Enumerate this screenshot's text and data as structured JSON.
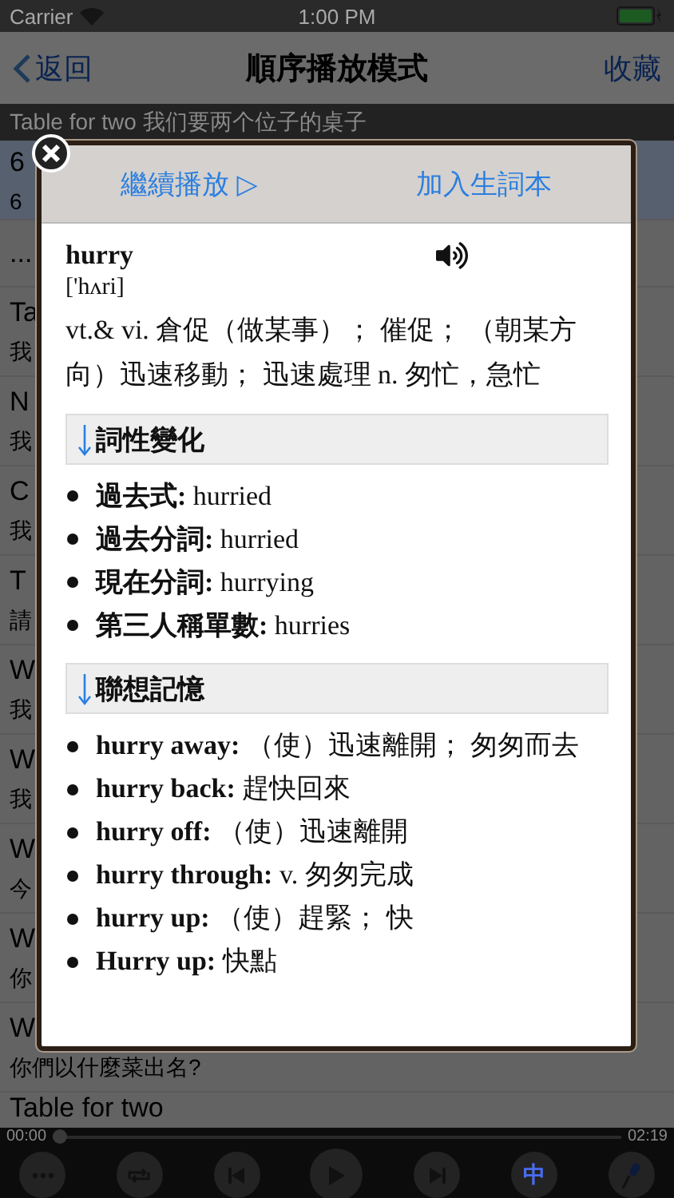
{
  "status_bar": {
    "carrier": "Carrier",
    "time": "1:00 PM"
  },
  "nav": {
    "back": "返回",
    "title": "順序播放模式",
    "action": "收藏"
  },
  "now_playing": "Table for two 我们要两个位子的桌子",
  "list": [
    {
      "title": "6",
      "subtitle": "6",
      "selected": true
    },
    {
      "title": "...",
      "selected": false
    },
    {
      "title": "Ta",
      "subtitle": "我",
      "selected": false
    },
    {
      "title": "N",
      "subtitle": "我",
      "selected": false
    },
    {
      "title": "C",
      "subtitle": "我",
      "selected": false
    },
    {
      "title": "T",
      "subtitle": "請",
      "selected": false
    },
    {
      "title": "W",
      "subtitle": "我",
      "selected": false
    },
    {
      "title": "W",
      "subtitle": "我",
      "selected": false
    },
    {
      "title": "W",
      "subtitle": "今",
      "selected": false
    },
    {
      "title": "W",
      "subtitle": "你",
      "selected": false
    },
    {
      "title": "W",
      "subtitle": "你們以什麼菜出名?",
      "selected": false
    },
    {
      "title": "Table for two",
      "selected": false
    }
  ],
  "popup": {
    "actions": [
      "繼續播放 ▷",
      "加入生詞本"
    ],
    "word": "hurry",
    "phonetic": "['hʌri]",
    "definition": "vt.& vi. 倉促（做某事）； 催促； （朝某方向）迅速移動； 迅速處理 n. 匆忙，急忙",
    "sections": [
      {
        "heading": "詞性變化",
        "kind": "forms",
        "items": [
          {
            "term": "過去式:",
            "text": "hurried"
          },
          {
            "term": "過去分詞:",
            "text": "hurried"
          },
          {
            "term": "現在分詞:",
            "text": "hurrying"
          },
          {
            "term": "第三人稱單數:",
            "text": "hurries"
          }
        ]
      },
      {
        "heading": "聯想記憶",
        "kind": "phrases",
        "items": [
          {
            "term": "hurry away:",
            "text": "（使）迅速離開； 匆匆而去"
          },
          {
            "term": "hurry back:",
            "text": "趕快回來"
          },
          {
            "term": "hurry off:",
            "text": "（使）迅速離開"
          },
          {
            "term": "hurry through:",
            "text": "v. 匆匆完成"
          },
          {
            "term": "hurry up:",
            "text": "（使）趕緊； 快"
          },
          {
            "term": "Hurry up:",
            "text": "快點"
          }
        ]
      }
    ]
  },
  "player": {
    "elapsed": "00:00",
    "total": "02:19",
    "level": 0,
    "language": "中"
  }
}
